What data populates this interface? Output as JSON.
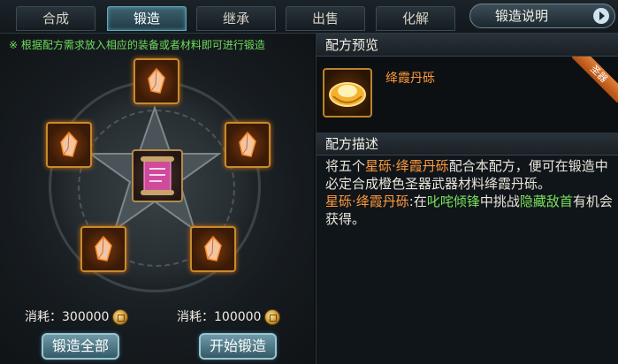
{
  "tabs": [
    {
      "label": "合成",
      "active": false
    },
    {
      "label": "锻造",
      "active": true
    },
    {
      "label": "继承",
      "active": false
    },
    {
      "label": "出售",
      "active": false
    },
    {
      "label": "化解",
      "active": false
    }
  ],
  "help_button": "锻造说明",
  "left": {
    "hint": "※ 根据配方需求放入相应的装备或者材料即可进行锻造",
    "cost_all_label": "消耗：",
    "cost_all_value": "300000",
    "cost_single_label": "消耗：",
    "cost_single_value": "100000",
    "forge_all_button": "锻造全部",
    "start_forge_button": "开始锻造"
  },
  "right": {
    "preview_title": "配方预览",
    "item_name": "绛霞丹砾",
    "ribbon": "圣器",
    "desc_title": "配方描述",
    "desc": {
      "p1_a": "将五个",
      "p1_b": "星砾·绛霞丹砾",
      "p1_c": "配合本配方，便可在锻造中必定合成橙色圣器武器材料绛霞丹砾。",
      "p2_a": "星砾·绛霞丹砾",
      "p2_b": ":在",
      "p2_c": "叱咤倾锋",
      "p2_d": "中挑战",
      "p2_e": "隐藏敌首",
      "p2_f": "有机会获得。"
    }
  },
  "colors": {
    "orange": "#ff9a3c",
    "green": "#79e25a",
    "hint_green": "#6fdc5c"
  }
}
